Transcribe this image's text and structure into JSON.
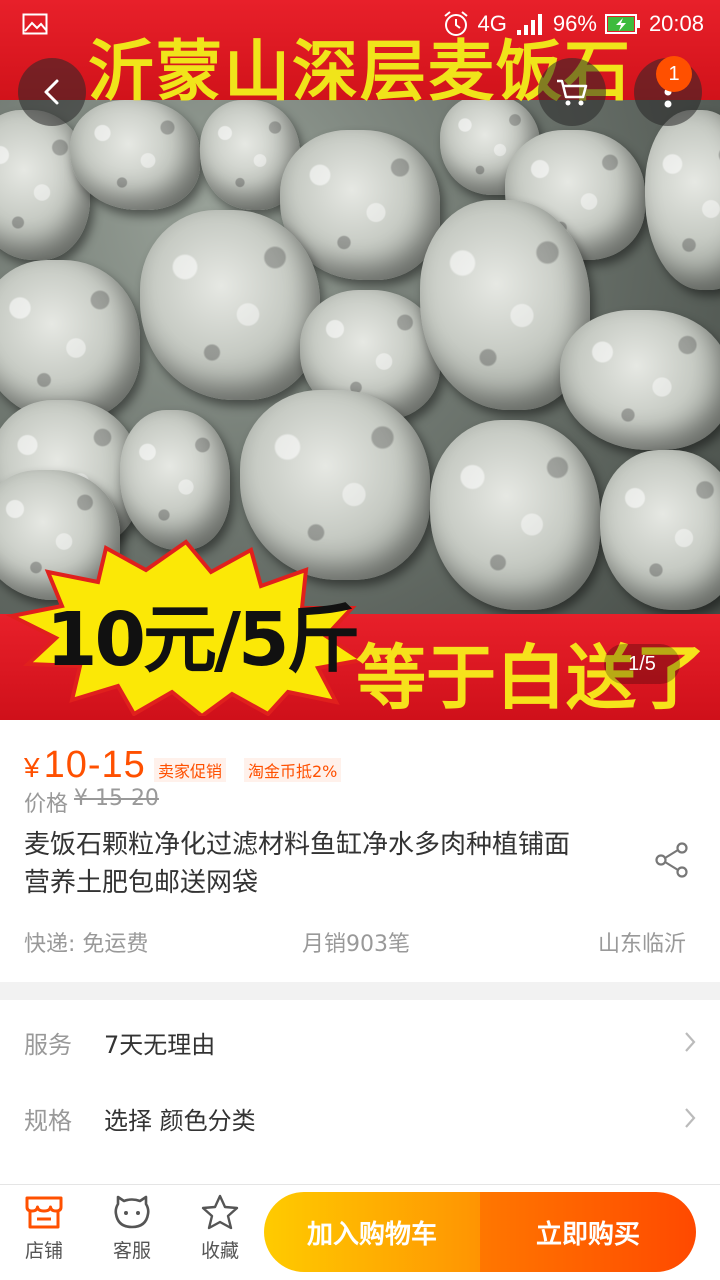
{
  "status_bar": {
    "network": "4G",
    "battery": "96%",
    "time": "20:08"
  },
  "hero": {
    "banner_top": "沂蒙山深层麦饭石",
    "burst_text": "10元/5斤",
    "banner_bottom": "等于白送了",
    "counter": "1/5"
  },
  "nav": {
    "cart_badge": "1"
  },
  "product": {
    "currency": "¥",
    "price": "10-15",
    "tags": [
      "卖家促销",
      "淘金币抵2%"
    ],
    "orig_label": "价格",
    "orig_value": "¥ 15-20",
    "title": "麦饭石颗粒净化过滤材料鱼缸净水多肉种植铺面营养土肥包邮送网袋",
    "shipping": "快递: 免运费",
    "monthly_sales": "月销903笔",
    "location": "山东临沂"
  },
  "options": [
    {
      "label": "服务",
      "value": "7天无理由"
    },
    {
      "label": "规格",
      "value": "选择 颜色分类"
    }
  ],
  "bottom_bar": {
    "shop": "店铺",
    "service": "客服",
    "favorite": "收藏",
    "add_to_cart": "加入购物车",
    "buy_now": "立即购买"
  },
  "colors": {
    "accent": "#ff5000",
    "cart_button": "#ffb000",
    "buy_button": "#ff6200"
  }
}
